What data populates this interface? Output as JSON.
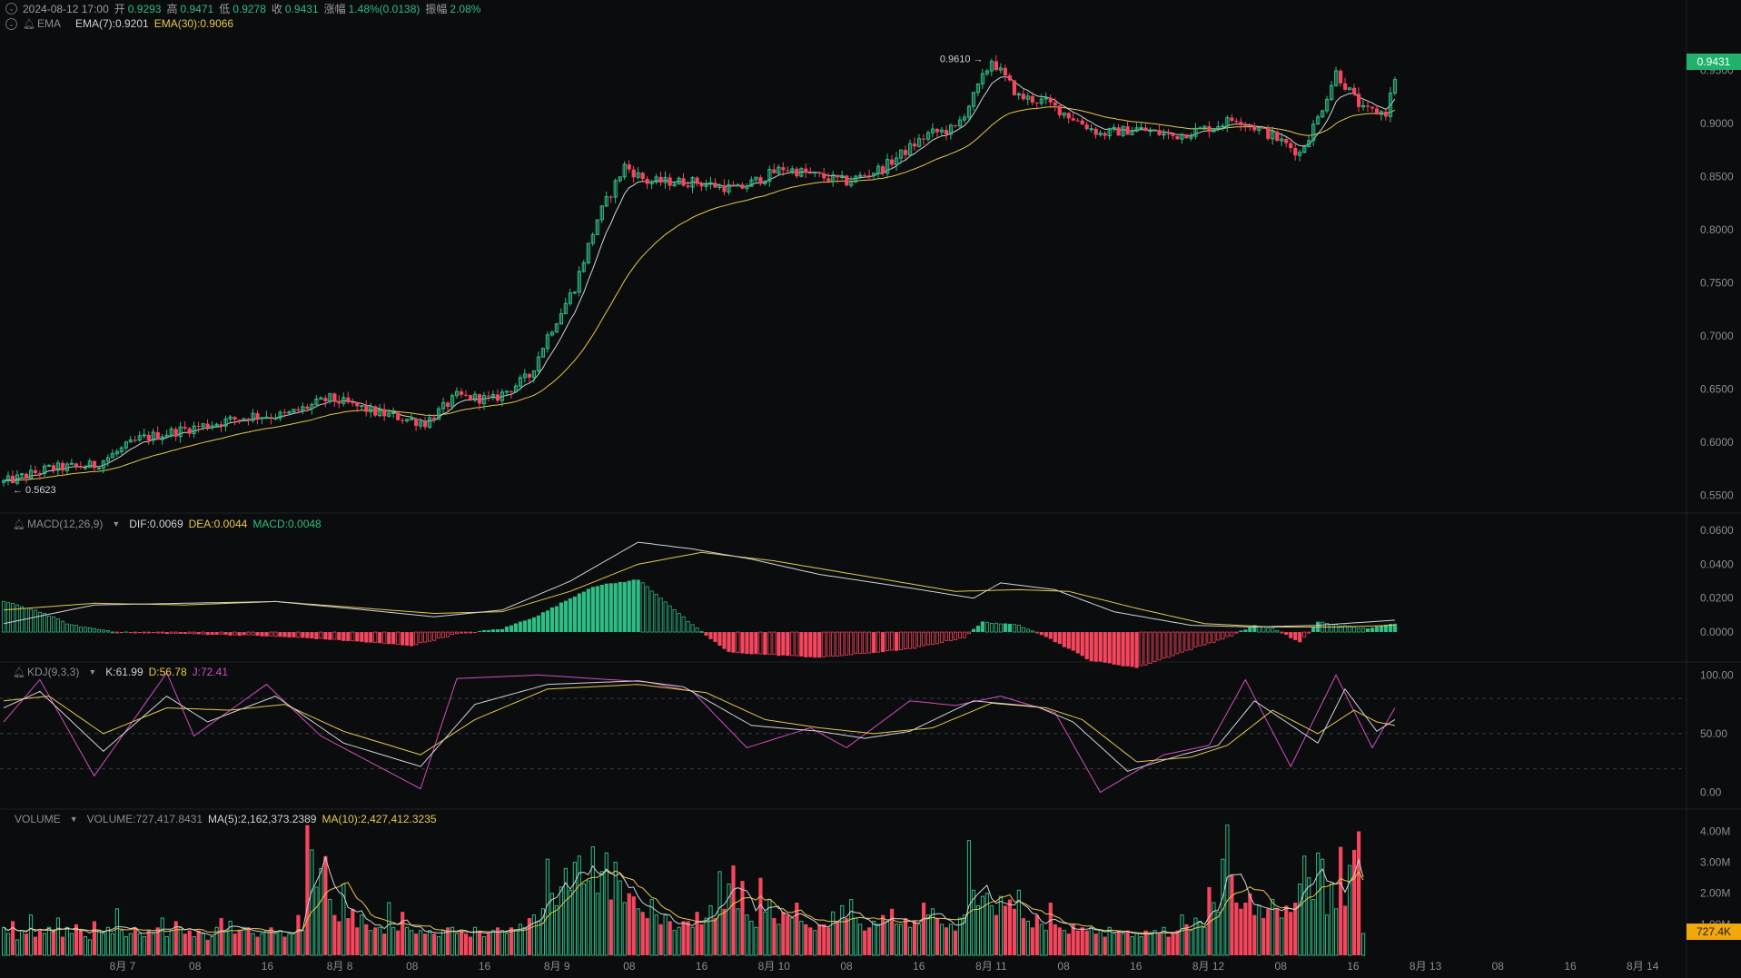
{
  "header": {
    "datetime": "2024-08-12 17:00",
    "open_label": "开",
    "open": "0.9293",
    "high_label": "高",
    "high": "0.9471",
    "low_label": "低",
    "low": "0.9278",
    "close_label": "收",
    "close": "0.9431",
    "change_label": "涨幅",
    "change": "1.48%(0.0138)",
    "amplitude_label": "振幅",
    "amplitude": "2.08%"
  },
  "ema_legend": {
    "name": "EMA",
    "ema7": "EMA(7):0.9201",
    "ema30": "EMA(30):0.9066"
  },
  "macd_legend": {
    "name": "MACD(12,26,9)",
    "dif": "DIF:0.0069",
    "dea": "DEA:0.0044",
    "macd": "MACD:0.0048"
  },
  "kdj_legend": {
    "name": "KDJ(9,3,3)",
    "k": "K:61.99",
    "d": "D:56.78",
    "j": "J:72.41"
  },
  "volume_legend": {
    "name": "VOLUME",
    "volume": "VOLUME:727,417.8431",
    "ma5": "MA(5):2,162,373.2389",
    "ma10": "MA(10):2,427,412.3235"
  },
  "price_tag": "0.9431",
  "volume_tag": "727.4K",
  "colors": {
    "up": "#2ebd85",
    "down": "#f6465d",
    "ema7": "#d0d2d6",
    "ema30": "#e7c84a",
    "j_line": "#d14ec1",
    "background": "#0b0c0e"
  },
  "chart_data": {
    "type": "candlestick",
    "interval": "1h",
    "x_axis_labels": [
      "8月 7",
      "08",
      "16",
      "8月 8",
      "08",
      "16",
      "8月 9",
      "08",
      "16",
      "8月 10",
      "08",
      "16",
      "8月 11",
      "08",
      "16",
      "8月 12",
      "08",
      "16",
      "8月 13",
      "08",
      "16",
      "8月 14"
    ],
    "price_axis": {
      "ticks": [
        "0.9500",
        "0.9000",
        "0.8500",
        "0.8000",
        "0.7500",
        "0.7000",
        "0.6500",
        "0.6000",
        "0.5500"
      ],
      "range": [
        0.5375,
        0.982
      ]
    },
    "annotations": {
      "max": "0.9610",
      "min": "0.5623"
    },
    "price_anchors": [
      [
        0,
        0.562
      ],
      [
        10,
        0.575
      ],
      [
        20,
        0.578
      ],
      [
        30,
        0.603
      ],
      [
        40,
        0.612
      ],
      [
        55,
        0.625
      ],
      [
        62,
        0.625
      ],
      [
        72,
        0.641
      ],
      [
        82,
        0.628
      ],
      [
        93,
        0.618
      ],
      [
        100,
        0.643
      ],
      [
        108,
        0.64
      ],
      [
        116,
        0.662
      ],
      [
        120,
        0.7
      ],
      [
        126,
        0.746
      ],
      [
        131,
        0.81
      ],
      [
        137,
        0.86
      ],
      [
        142,
        0.845
      ],
      [
        152,
        0.845
      ],
      [
        162,
        0.838
      ],
      [
        172,
        0.858
      ],
      [
        180,
        0.85
      ],
      [
        186,
        0.845
      ],
      [
        194,
        0.858
      ],
      [
        204,
        0.89
      ],
      [
        210,
        0.895
      ],
      [
        214,
        0.925
      ],
      [
        218,
        0.96
      ],
      [
        224,
        0.925
      ],
      [
        230,
        0.92
      ],
      [
        236,
        0.905
      ],
      [
        242,
        0.89
      ],
      [
        250,
        0.895
      ],
      [
        258,
        0.888
      ],
      [
        266,
        0.896
      ],
      [
        272,
        0.905
      ],
      [
        280,
        0.888
      ],
      [
        286,
        0.872
      ],
      [
        290,
        0.905
      ],
      [
        294,
        0.948
      ],
      [
        300,
        0.912
      ],
      [
        305,
        0.91
      ],
      [
        307,
        0.943
      ]
    ],
    "macd": {
      "ticks": [
        "0.0600",
        "0.0400",
        "0.0200",
        "0.0000"
      ],
      "range": [
        -0.0155,
        0.0675
      ],
      "hist_anchors": [
        [
          0,
          0.018
        ],
        [
          8,
          0.012
        ],
        [
          15,
          0.004
        ],
        [
          25,
          0.0
        ],
        [
          40,
          -0.001
        ],
        [
          55,
          -0.002
        ],
        [
          70,
          -0.004
        ],
        [
          90,
          -0.008
        ],
        [
          100,
          -0.001
        ],
        [
          110,
          0.002
        ],
        [
          118,
          0.01
        ],
        [
          130,
          0.027
        ],
        [
          140,
          0.031
        ],
        [
          146,
          0.018
        ],
        [
          152,
          0.004
        ],
        [
          160,
          -0.012
        ],
        [
          180,
          -0.015
        ],
        [
          200,
          -0.01
        ],
        [
          212,
          -0.003
        ],
        [
          216,
          0.006
        ],
        [
          224,
          0.004
        ],
        [
          228,
          0.0
        ],
        [
          240,
          -0.017
        ],
        [
          250,
          -0.021
        ],
        [
          262,
          -0.01
        ],
        [
          270,
          -0.003
        ],
        [
          276,
          0.004
        ],
        [
          280,
          0.002
        ],
        [
          286,
          -0.006
        ],
        [
          290,
          0.006
        ],
        [
          300,
          0.002
        ],
        [
          307,
          0.005
        ]
      ],
      "dif_anchors": [
        [
          0,
          0.005
        ],
        [
          20,
          0.016
        ],
        [
          40,
          0.017
        ],
        [
          60,
          0.018
        ],
        [
          80,
          0.013
        ],
        [
          95,
          0.009
        ],
        [
          110,
          0.013
        ],
        [
          125,
          0.03
        ],
        [
          140,
          0.053
        ],
        [
          152,
          0.049
        ],
        [
          165,
          0.043
        ],
        [
          180,
          0.034
        ],
        [
          200,
          0.026
        ],
        [
          214,
          0.02
        ],
        [
          220,
          0.029
        ],
        [
          232,
          0.025
        ],
        [
          245,
          0.012
        ],
        [
          262,
          0.004
        ],
        [
          276,
          0.003
        ],
        [
          290,
          0.004
        ],
        [
          307,
          0.007
        ]
      ],
      "dea_anchors": [
        [
          0,
          0.013
        ],
        [
          20,
          0.017
        ],
        [
          40,
          0.016
        ],
        [
          60,
          0.018
        ],
        [
          80,
          0.014
        ],
        [
          95,
          0.011
        ],
        [
          110,
          0.012
        ],
        [
          125,
          0.024
        ],
        [
          140,
          0.04
        ],
        [
          154,
          0.047
        ],
        [
          170,
          0.042
        ],
        [
          190,
          0.033
        ],
        [
          210,
          0.024
        ],
        [
          224,
          0.025
        ],
        [
          235,
          0.024
        ],
        [
          250,
          0.014
        ],
        [
          265,
          0.005
        ],
        [
          280,
          0.003
        ],
        [
          295,
          0.003
        ],
        [
          307,
          0.004
        ]
      ]
    },
    "kdj": {
      "ticks": [
        "100.00",
        "50.00",
        "0.00"
      ],
      "range": [
        -12,
        108
      ],
      "k_anchors": [
        [
          0,
          72
        ],
        [
          8,
          86
        ],
        [
          22,
          35
        ],
        [
          36,
          82
        ],
        [
          45,
          60
        ],
        [
          60,
          82
        ],
        [
          75,
          42
        ],
        [
          92,
          22
        ],
        [
          104,
          75
        ],
        [
          120,
          92
        ],
        [
          140,
          95
        ],
        [
          150,
          90
        ],
        [
          165,
          57
        ],
        [
          180,
          52
        ],
        [
          190,
          46
        ],
        [
          200,
          52
        ],
        [
          214,
          78
        ],
        [
          228,
          73
        ],
        [
          236,
          60
        ],
        [
          248,
          18
        ],
        [
          260,
          32
        ],
        [
          268,
          40
        ],
        [
          276,
          78
        ],
        [
          290,
          42
        ],
        [
          296,
          88
        ],
        [
          303,
          52
        ],
        [
          307,
          62
        ]
      ],
      "d_anchors": [
        [
          0,
          78
        ],
        [
          10,
          82
        ],
        [
          22,
          50
        ],
        [
          36,
          72
        ],
        [
          50,
          70
        ],
        [
          62,
          75
        ],
        [
          75,
          52
        ],
        [
          92,
          32
        ],
        [
          104,
          62
        ],
        [
          120,
          88
        ],
        [
          140,
          92
        ],
        [
          155,
          85
        ],
        [
          168,
          62
        ],
        [
          180,
          55
        ],
        [
          192,
          50
        ],
        [
          205,
          55
        ],
        [
          218,
          76
        ],
        [
          230,
          72
        ],
        [
          238,
          62
        ],
        [
          250,
          26
        ],
        [
          262,
          30
        ],
        [
          270,
          40
        ],
        [
          280,
          70
        ],
        [
          290,
          50
        ],
        [
          298,
          70
        ],
        [
          303,
          60
        ],
        [
          307,
          57
        ]
      ],
      "j_anchors": [
        [
          0,
          60
        ],
        [
          8,
          96
        ],
        [
          20,
          14
        ],
        [
          36,
          102
        ],
        [
          42,
          48
        ],
        [
          58,
          92
        ],
        [
          70,
          48
        ],
        [
          92,
          3
        ],
        [
          100,
          97
        ],
        [
          118,
          100
        ],
        [
          142,
          94
        ],
        [
          152,
          86
        ],
        [
          164,
          38
        ],
        [
          178,
          55
        ],
        [
          186,
          38
        ],
        [
          200,
          78
        ],
        [
          210,
          74
        ],
        [
          220,
          82
        ],
        [
          232,
          68
        ],
        [
          242,
          0
        ],
        [
          256,
          32
        ],
        [
          266,
          40
        ],
        [
          274,
          96
        ],
        [
          284,
          22
        ],
        [
          294,
          100
        ],
        [
          302,
          38
        ],
        [
          307,
          72
        ]
      ],
      "dashed_levels": [
        80,
        50,
        20
      ]
    },
    "volume": {
      "ticks": [
        "4.00M",
        "3.00M",
        "2.00M",
        "1.00M"
      ],
      "range": [
        0,
        4.6
      ],
      "values_m": [
        0.9,
        0.7,
        1.1,
        0.5,
        0.8,
        0.7,
        1.3,
        0.6,
        0.8,
        0.7,
        0.9,
        0.8,
        1.2,
        0.6,
        0.9,
        0.7,
        1.0,
        0.8,
        0.6,
        0.5,
        1.1,
        0.8,
        0.7,
        0.9,
        0.7,
        1.5,
        0.8,
        0.6,
        0.7,
        0.9,
        0.7,
        0.6,
        0.8,
        0.7,
        0.9,
        1.2,
        0.6,
        0.8,
        1.1,
        0.9,
        0.7,
        0.8,
        0.6,
        0.8,
        0.7,
        0.5,
        0.6,
        0.9,
        1.2,
        0.8,
        1.1,
        0.7,
        0.8,
        0.9,
        0.9,
        0.7,
        0.6,
        0.7,
        0.8,
        0.9,
        0.7,
        0.8,
        0.6,
        0.7,
        0.7,
        1.3,
        0.8,
        4.2,
        3.4,
        2.2,
        2.8,
        3.2,
        1.8,
        1.3,
        1.1,
        2.3,
        1.2,
        1.5,
        0.9,
        1.3,
        1.0,
        0.8,
        0.9,
        0.9,
        0.7,
        1.7,
        0.9,
        0.8,
        1.4,
        0.9,
        0.8,
        0.7,
        0.8,
        0.7,
        0.8,
        0.7,
        0.6,
        0.8,
        0.9,
        0.9,
        0.7,
        0.8,
        0.7,
        0.6,
        0.9,
        0.8,
        0.6,
        0.7,
        0.8,
        0.9,
        0.8,
        0.7,
        0.9,
        0.8,
        1.0,
        0.9,
        1.2,
        1.3,
        1.1,
        1.5,
        3.1,
        2.0,
        1.6,
        2.2,
        2.8,
        2.1,
        3.0,
        3.2,
        2.3,
        2.4,
        3.5,
        2.0,
        2.7,
        3.3,
        1.8,
        3.0,
        2.4,
        1.7,
        2.0,
        1.9,
        1.5,
        1.4,
        1.2,
        1.8,
        1.3,
        1.0,
        1.3,
        1.1,
        0.8,
        0.9,
        1.1,
        1.1,
        0.9,
        1.4,
        1.0,
        1.2,
        1.6,
        1.2,
        2.7,
        1.5,
        2.3,
        2.9,
        1.5,
        2.4,
        1.3,
        1.1,
        0.9,
        2.5,
        1.4,
        1.8,
        1.2,
        1.0,
        1.4,
        1.3,
        1.2,
        1.7,
        1.1,
        1.0,
        0.9,
        0.8,
        1.0,
        1.0,
        0.9,
        1.4,
        1.1,
        1.6,
        1.2,
        1.8,
        1.2,
        1.0,
        0.8,
        0.9,
        1.1,
        1.0,
        1.3,
        1.1,
        1.5,
        1.0,
        1.0,
        1.2,
        0.9,
        1.1,
        1.0,
        1.7,
        1.3,
        1.5,
        1.2,
        1.0,
        0.9,
        1.0,
        0.8,
        1.2,
        1.3,
        3.7,
        2.1,
        1.6,
        1.9,
        2.0,
        1.6,
        1.3,
        1.9,
        1.6,
        1.8,
        1.5,
        2.1,
        1.2,
        1.1,
        0.9,
        1.3,
        1.0,
        0.8,
        1.7,
        1.0,
        0.9,
        0.8,
        0.7,
        1.0,
        0.8,
        0.9,
        0.8,
        0.9,
        0.7,
        0.8,
        0.6,
        0.9,
        0.7,
        0.8,
        0.7,
        0.8,
        0.6,
        0.7,
        0.6,
        0.8,
        0.7,
        0.8,
        0.7,
        0.9,
        0.6,
        0.7,
        0.8,
        1.3,
        1.0,
        0.8,
        1.2,
        1.1,
        0.9,
        2.2,
        1.7,
        1.4,
        3.1,
        4.2,
        2.6,
        1.7,
        1.5,
        1.7,
        2.0,
        1.3,
        1.6,
        1.2,
        1.5,
        1.8,
        1.5,
        1.2,
        1.6,
        1.4,
        1.7,
        2.3,
        3.2,
        2.5,
        1.8,
        3.3,
        3.1,
        1.3,
        2.3,
        1.5,
        3.5,
        1.6,
        2.9,
        3.4,
        4.0,
        0.7
      ],
      "colors_pattern": "matches candle direction"
    },
    "candle_count": 308
  }
}
